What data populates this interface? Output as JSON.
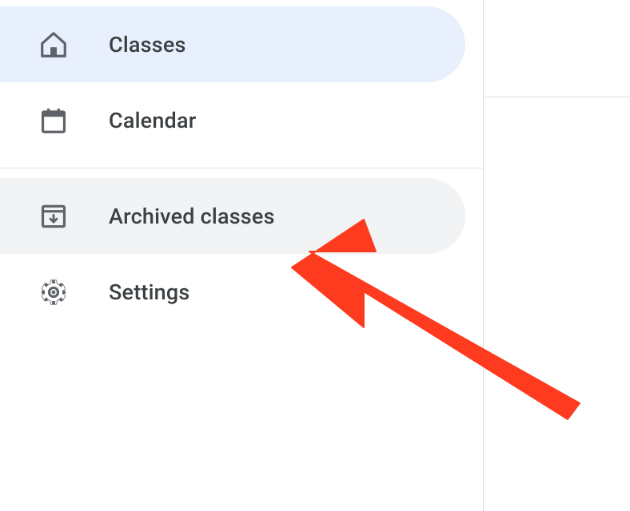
{
  "sidebar": {
    "items": [
      {
        "label": "Classes",
        "icon": "home-icon",
        "active": true
      },
      {
        "label": "Calendar",
        "icon": "calendar-icon",
        "active": false
      },
      {
        "label": "Archived classes",
        "icon": "archive-icon",
        "active": false,
        "hover": true
      },
      {
        "label": "Settings",
        "icon": "gear-icon",
        "active": false
      }
    ]
  },
  "colors": {
    "active_bg": "#e8f0fe",
    "hover_bg": "#f1f3f4",
    "icon_color": "#5f6368",
    "text_color": "#3c4043",
    "arrow_color": "#ff3b1f"
  }
}
